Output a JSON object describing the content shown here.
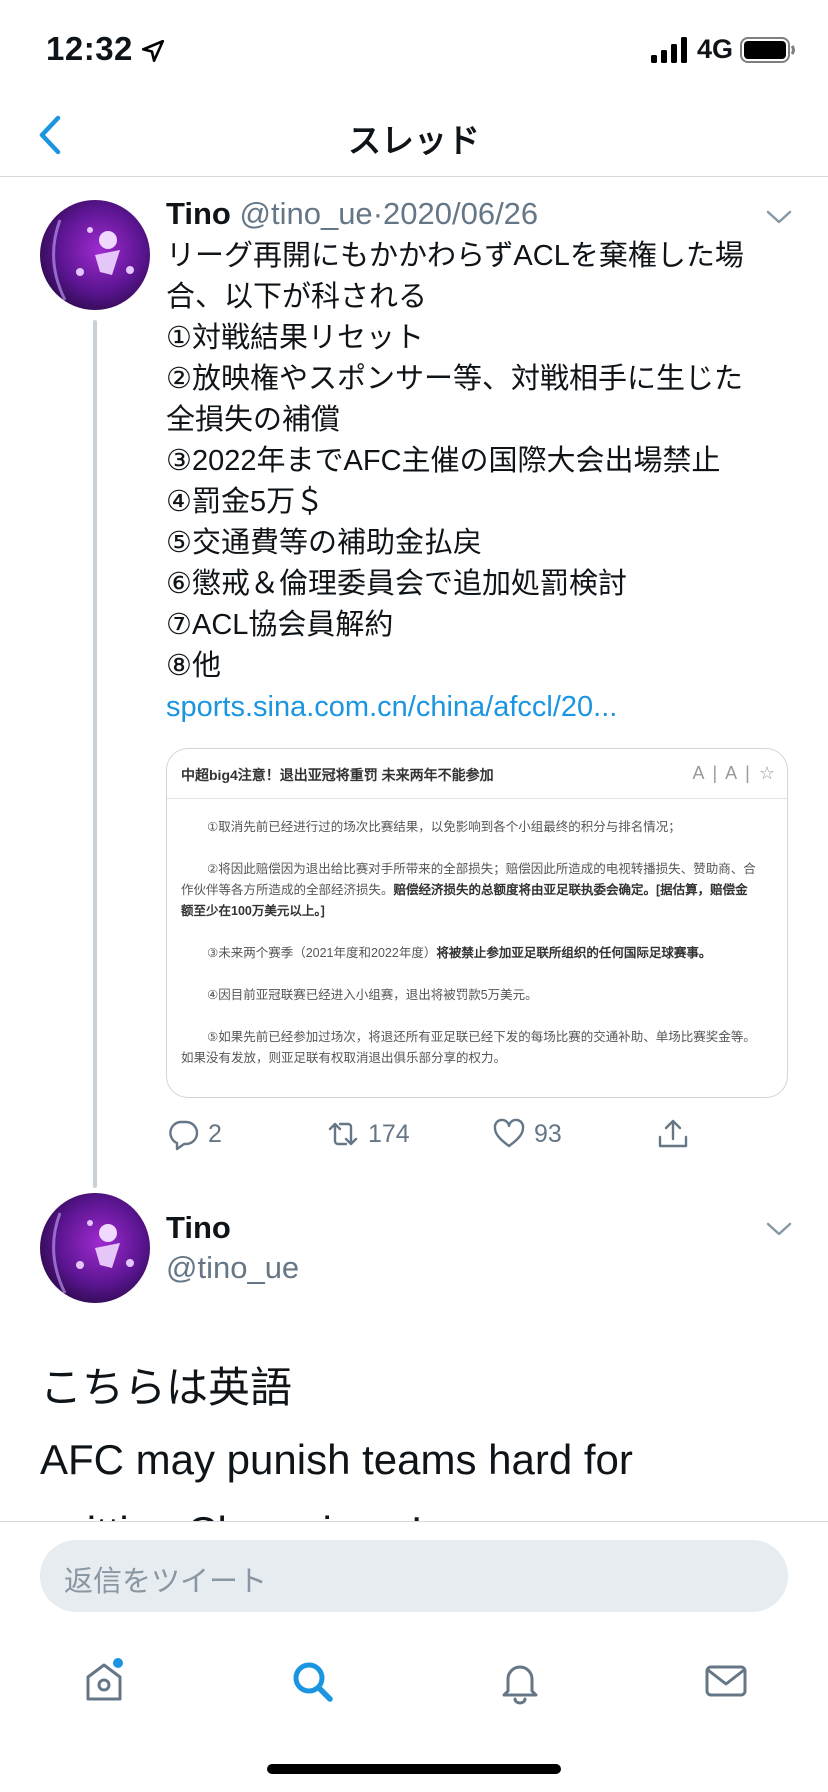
{
  "status_bar": {
    "time": "12:32",
    "network": "4G",
    "icons": [
      "location-arrow-icon",
      "cellular-signal-icon",
      "battery-icon"
    ]
  },
  "nav": {
    "title": "スレッド",
    "back_icon": "chevron-left-icon"
  },
  "tweet1": {
    "author_name": "Tino",
    "handle": "@tino_ue",
    "separator": "·",
    "date": "2020/06/26",
    "body_lines": [
      "リーグ再開にもかかわらずACLを棄権した場",
      "合、以下が科される",
      "①対戦結果リセット",
      "②放映権やスポンサー等、対戦相手に生じた",
      "全損失の補償",
      "③2022年までAFC主催の国際大会出場禁止",
      "④罰金5万＄",
      "⑤交通費等の補助金払戻",
      "⑥懲戒＆倫理委員会で追加処罰検討",
      "⑦ACL協会員解約",
      "⑧他"
    ],
    "link": "sports.sina.com.cn/china/afccl/20...",
    "media": {
      "title": "中超big4注意！退出亚冠将重罚 未来两年不能参加",
      "tools": "A | A | ☆",
      "p1": "①取消先前已经进行过的场次比赛结果，以免影响到各个小组最终的积分与排名情况；",
      "p2a": "②将因此赔偿因为退出给比赛对手所带来的全部损失；赔偿因此所造成的电视转播损失、赞助商、合",
      "p2b": "作伙伴等各方所造成的全部经济损失。",
      "p2b_bold": "赔偿经济损失的总额度将由亚足联执委会确定。[据估算，赔偿金",
      "p2c_bold": "额至少在100万美元以上。]",
      "p3": "③未来两个赛季（2021年度和2022年度）",
      "p3_bold": "将被禁止参加亚足联所组织的任何国际足球赛事。",
      "p4": "④因目前亚冠联赛已经进入小组赛，退出将被罚款5万美元。",
      "p5a": "⑤如果先前已经参加过场次，将退还所有亚足联已经下发的每场比赛的交通补助、单场比赛奖金等。",
      "p5b": "如果没有发放，则亚足联有权取消退出俱乐部分享的权力。"
    },
    "actions": {
      "reply_count": "2",
      "retweet_count": "174",
      "like_count": "93"
    }
  },
  "tweet2": {
    "author_name": "Tino",
    "handle": "@tino_ue",
    "body_lines": [
      "こちらは英語",
      "AFC may punish teams hard for",
      "quitting Champions League"
    ]
  },
  "reply": {
    "placeholder": "返信をツイート"
  },
  "tab_bar": {
    "tabs": [
      "home-icon",
      "search-icon",
      "notifications-bell-icon",
      "messages-envelope-icon"
    ],
    "active": "search-icon"
  },
  "colors": {
    "accent": "#1b95e0",
    "secondary_text": "#657786",
    "divider": "#d6dade",
    "input_bg": "#e6ecf0"
  }
}
